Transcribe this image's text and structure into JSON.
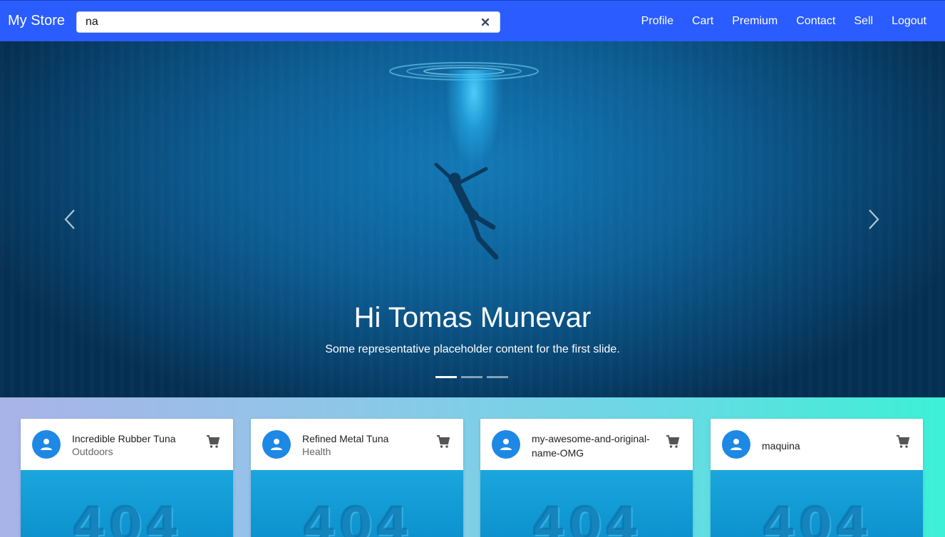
{
  "navbar": {
    "brand": "My Store",
    "search_value": "na",
    "links": [
      "Profile",
      "Cart",
      "Premium",
      "Contact",
      "Sell",
      "Logout"
    ]
  },
  "carousel": {
    "title": "Hi Tomas Munevar",
    "text": "Some representative placeholder content for the first slide.",
    "slide_count": 3,
    "active_slide": 1
  },
  "products": [
    {
      "name": "Incredible Rubber Tuna",
      "category": "Outdoors",
      "image_text": "404"
    },
    {
      "name": "Refined Metal Tuna",
      "category": "Health",
      "image_text": "404"
    },
    {
      "name": "my-awesome-and-original-name-OMG",
      "category": "",
      "image_text": "404"
    },
    {
      "name": "maquina",
      "category": "",
      "image_text": "404"
    }
  ],
  "colors": {
    "navbar": "#2a5cff",
    "avatar": "#1e88e5",
    "media": "#1aa6dc"
  },
  "icons": {
    "clear": "close-icon",
    "prev": "chevron-left-icon",
    "next": "chevron-right-icon",
    "avatar": "person-icon",
    "cart": "cart-icon"
  }
}
